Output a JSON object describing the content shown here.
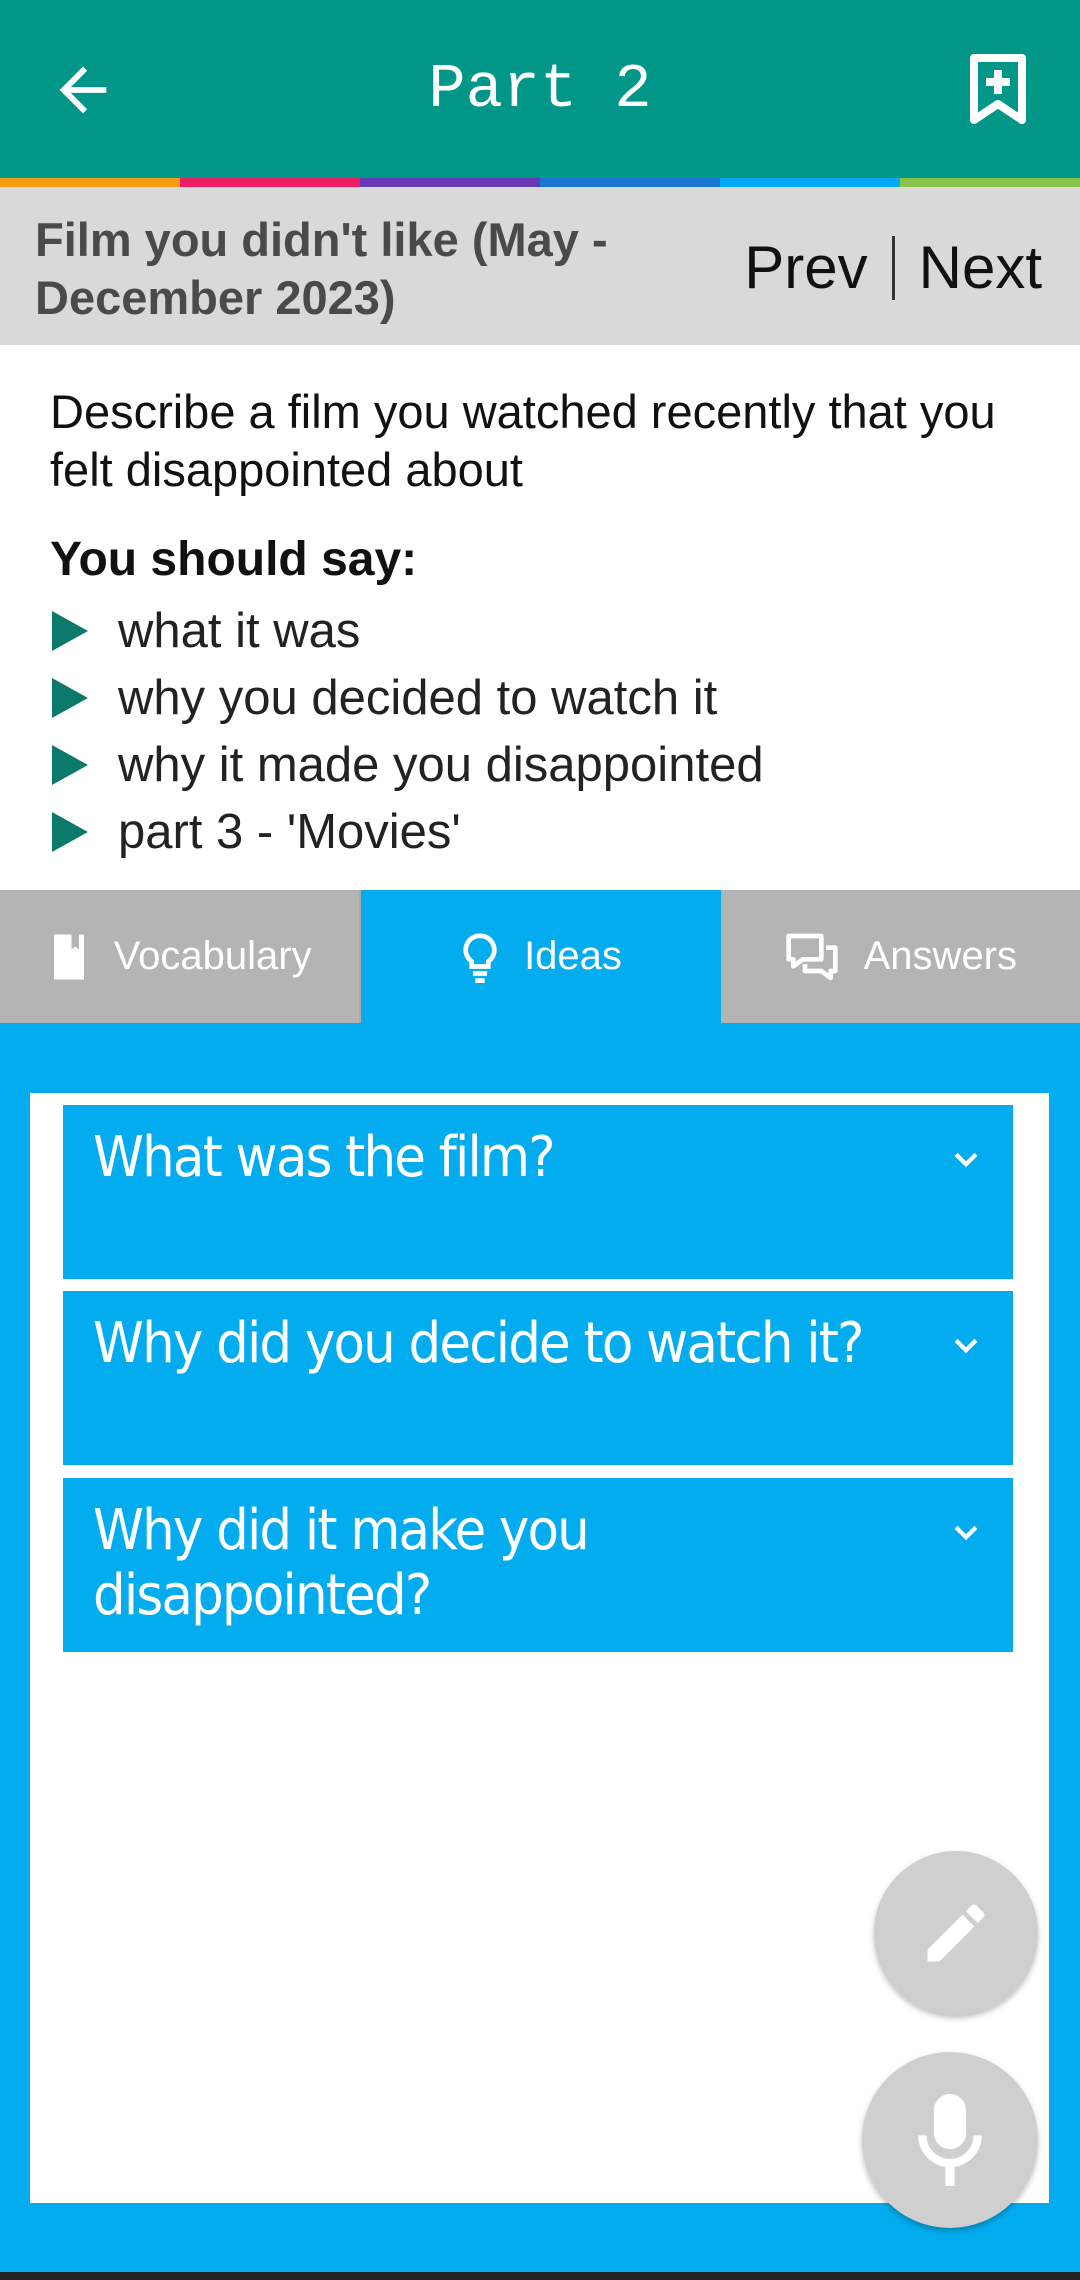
{
  "appbar": {
    "title": "Part 2",
    "back_icon": "arrow-left-icon",
    "bookmark_icon": "bookmark-add-icon"
  },
  "stripe_colors": [
    "#f39c12",
    "#e91e63",
    "#673ab7",
    "#1976d2",
    "#03a9f4",
    "#8bc34a"
  ],
  "topic": {
    "title": "Film you didn't like (May - December 2023)",
    "prev_label": "Prev",
    "next_label": "Next"
  },
  "cue_card": {
    "description": "Describe a film you watched recently that you felt disappointed about",
    "heading": "You should say:",
    "items": [
      "what it was",
      "why you decided to watch it",
      "why it made you disappointed",
      "part 3 - 'Movies'"
    ]
  },
  "tabs": [
    {
      "label": "Vocabulary",
      "icon": "book-icon",
      "active": false
    },
    {
      "label": "Ideas",
      "icon": "lightbulb-icon",
      "active": true
    },
    {
      "label": "Answers",
      "icon": "chat-bubbles-icon",
      "active": false
    }
  ],
  "questions": [
    "What was the film?",
    "Why did you decide to watch it?",
    "Why did it make you disappointed?"
  ],
  "fabs": {
    "edit_icon": "pencil-icon",
    "mic_icon": "microphone-icon"
  },
  "colors": {
    "appbar": "#009688",
    "accent": "#03acee",
    "tab_inactive": "#b4b4b4",
    "bullet": "#0b7a6b"
  }
}
